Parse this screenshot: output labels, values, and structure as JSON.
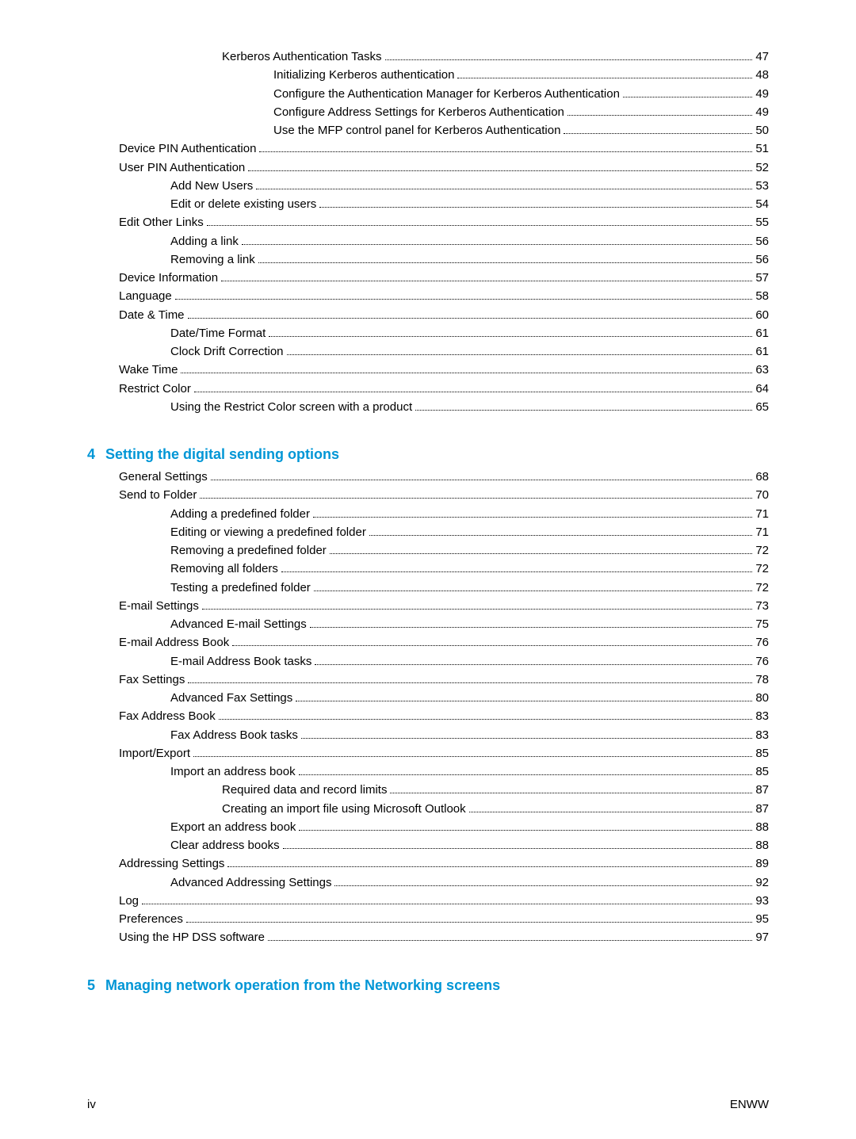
{
  "block1": [
    {
      "indent": 2,
      "label": "Kerberos Authentication Tasks",
      "page": "47"
    },
    {
      "indent": 3,
      "label": "Initializing Kerberos authentication",
      "page": "48"
    },
    {
      "indent": 3,
      "label": "Configure the Authentication Manager for Kerberos Authentication",
      "page": "49"
    },
    {
      "indent": 3,
      "label": "Configure Address Settings for Kerberos Authentication",
      "page": "49"
    },
    {
      "indent": 3,
      "label": "Use the MFP control panel for Kerberos Authentication",
      "page": "50"
    },
    {
      "indent": 0,
      "label": "Device PIN Authentication",
      "page": "51"
    },
    {
      "indent": 0,
      "label": "User PIN Authentication",
      "page": "52"
    },
    {
      "indent": 1,
      "label": "Add New Users",
      "page": "53"
    },
    {
      "indent": 1,
      "label": "Edit or delete existing users",
      "page": "54"
    },
    {
      "indent": 0,
      "label": "Edit Other Links",
      "page": "55"
    },
    {
      "indent": 1,
      "label": "Adding a link",
      "page": "56"
    },
    {
      "indent": 1,
      "label": "Removing a link",
      "page": "56"
    },
    {
      "indent": 0,
      "label": "Device Information",
      "page": "57"
    },
    {
      "indent": 0,
      "label": "Language",
      "page": "58"
    },
    {
      "indent": 0,
      "label": "Date & Time",
      "page": "60"
    },
    {
      "indent": 1,
      "label": "Date/Time Format",
      "page": "61"
    },
    {
      "indent": 1,
      "label": "Clock Drift Correction",
      "page": "61"
    },
    {
      "indent": 0,
      "label": "Wake Time",
      "page": "63"
    },
    {
      "indent": 0,
      "label": "Restrict Color",
      "page": "64"
    },
    {
      "indent": 1,
      "label": "Using the Restrict Color screen with a product",
      "page": "65"
    }
  ],
  "section4": {
    "num": "4",
    "title": "Setting the digital sending options"
  },
  "block2": [
    {
      "indent": 0,
      "label": "General Settings",
      "page": "68"
    },
    {
      "indent": 0,
      "label": "Send to Folder",
      "page": "70"
    },
    {
      "indent": 1,
      "label": "Adding a predefined folder",
      "page": "71"
    },
    {
      "indent": 1,
      "label": "Editing or viewing a predefined folder",
      "page": "71"
    },
    {
      "indent": 1,
      "label": "Removing a predefined folder",
      "page": "72"
    },
    {
      "indent": 1,
      "label": "Removing all folders",
      "page": "72"
    },
    {
      "indent": 1,
      "label": "Testing a predefined folder",
      "page": "72"
    },
    {
      "indent": 0,
      "label": "E-mail Settings",
      "page": "73"
    },
    {
      "indent": 1,
      "label": "Advanced E-mail Settings",
      "page": "75"
    },
    {
      "indent": 0,
      "label": "E-mail Address Book",
      "page": "76"
    },
    {
      "indent": 1,
      "label": "E-mail Address Book tasks",
      "page": "76"
    },
    {
      "indent": 0,
      "label": "Fax Settings",
      "page": "78"
    },
    {
      "indent": 1,
      "label": "Advanced Fax Settings ",
      "page": "80"
    },
    {
      "indent": 0,
      "label": "Fax Address Book",
      "page": "83"
    },
    {
      "indent": 1,
      "label": "Fax Address Book tasks",
      "page": "83"
    },
    {
      "indent": 0,
      "label": "Import/Export",
      "page": "85"
    },
    {
      "indent": 1,
      "label": "Import an address book",
      "page": "85"
    },
    {
      "indent": 2,
      "label": "Required data and record limits",
      "page": "87"
    },
    {
      "indent": 2,
      "label": "Creating an import file using Microsoft Outlook",
      "page": "87"
    },
    {
      "indent": 1,
      "label": "Export an address book",
      "page": "88"
    },
    {
      "indent": 1,
      "label": "Clear address books",
      "page": "88"
    },
    {
      "indent": 0,
      "label": "Addressing Settings",
      "page": "89"
    },
    {
      "indent": 1,
      "label": "Advanced Addressing Settings",
      "page": "92"
    },
    {
      "indent": 0,
      "label": "Log",
      "page": "93"
    },
    {
      "indent": 0,
      "label": "Preferences",
      "page": "95"
    },
    {
      "indent": 0,
      "label": "Using the HP DSS software",
      "page": "97"
    }
  ],
  "section5": {
    "num": "5",
    "title": "Managing network operation from the Networking screens"
  },
  "footer": {
    "pagenum": "iv",
    "right": "ENWW"
  }
}
